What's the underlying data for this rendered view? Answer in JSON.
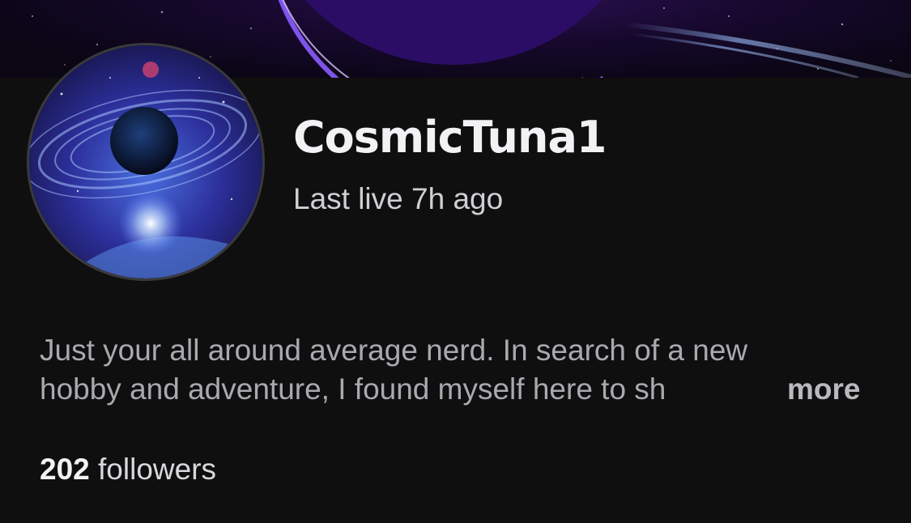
{
  "banner": {
    "image": "space-planet-banner",
    "accent": "#7b3cff"
  },
  "profile": {
    "avatar": "saturn-galaxy-avatar",
    "username": "CosmicTuna1",
    "last_live": "Last live 7h ago",
    "bio_line1": "Just your all around average nerd. In search of a new",
    "bio_line2": "hobby and adventure, I found myself here to sh",
    "more_label": "more",
    "followers_count": "202",
    "followers_label": "followers"
  },
  "colors": {
    "background": "#0f0f10",
    "text_primary": "#f2f2f4",
    "text_secondary": "#a9a9af"
  }
}
